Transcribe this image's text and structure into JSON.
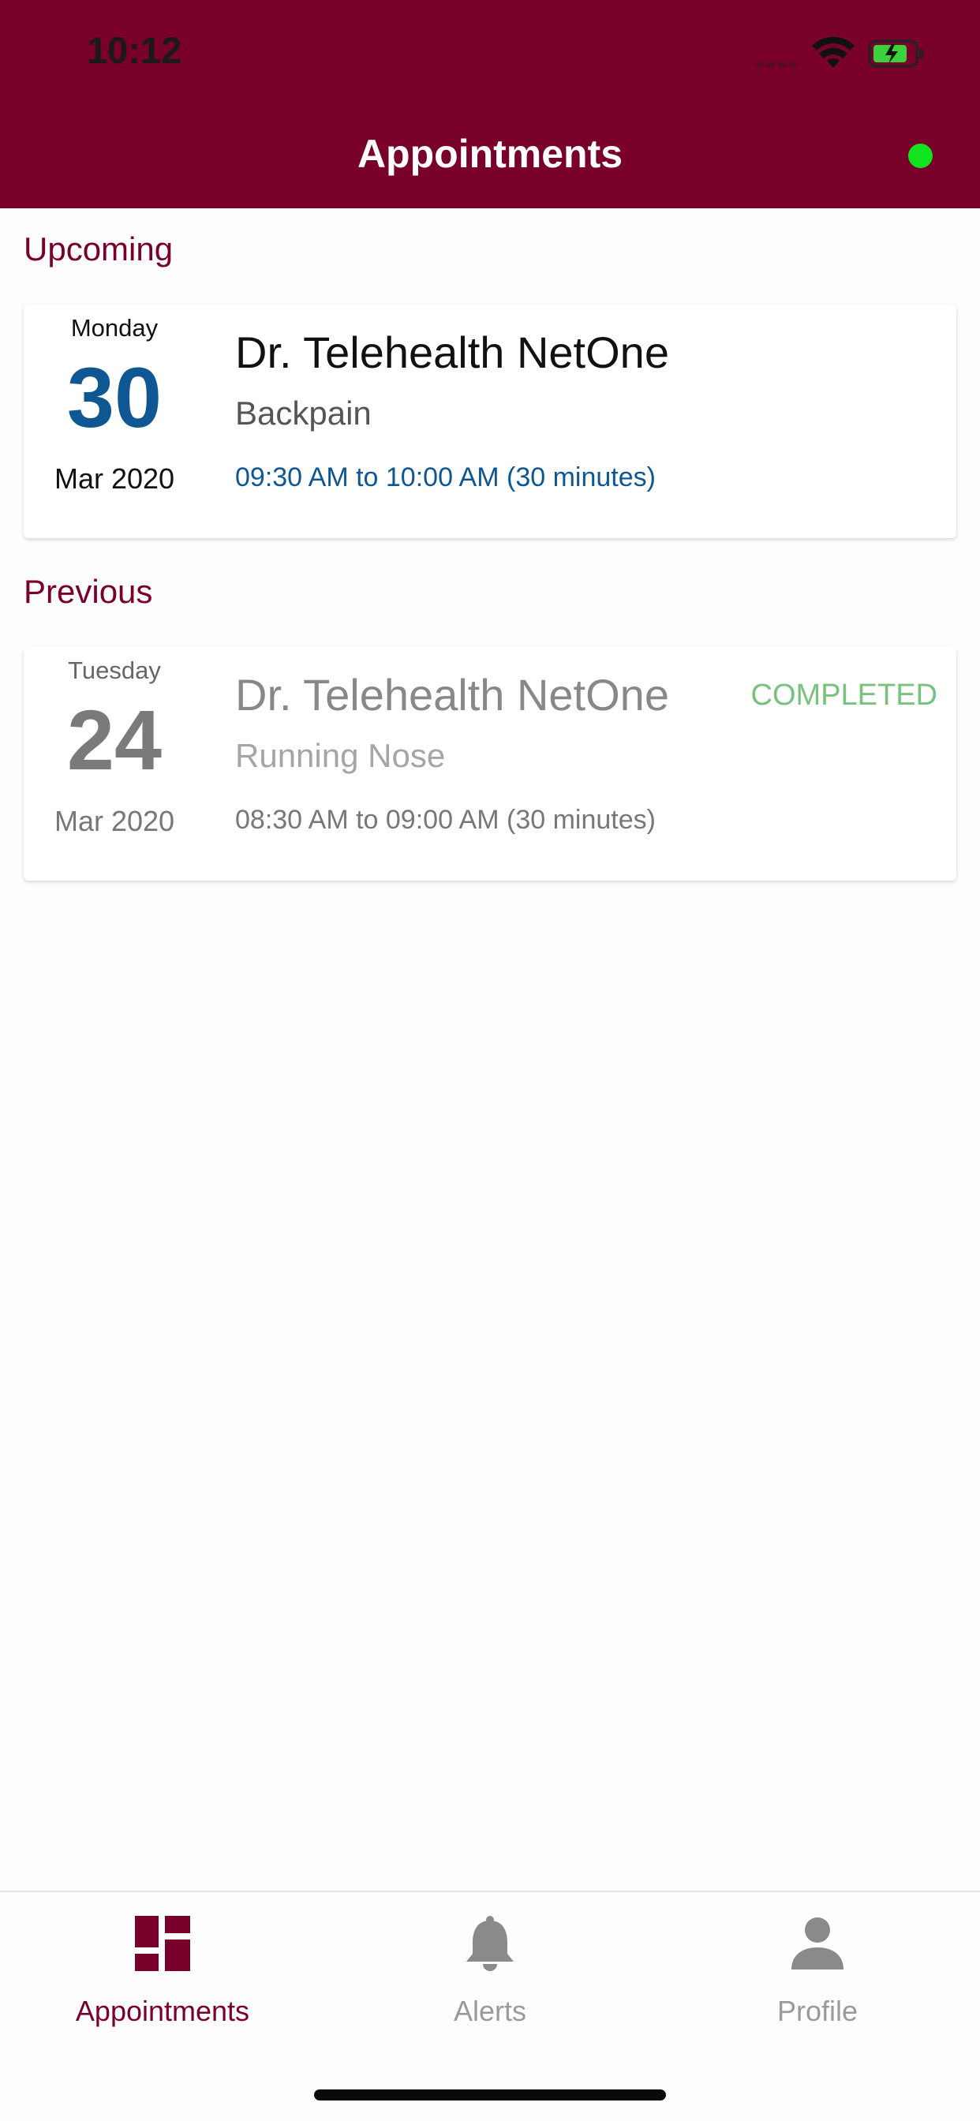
{
  "status_bar": {
    "time": "10:12"
  },
  "header": {
    "title": "Appointments",
    "online_color": "#12e31f"
  },
  "sections": {
    "upcoming_label": "Upcoming",
    "previous_label": "Previous"
  },
  "upcoming": [
    {
      "weekday": "Monday",
      "day": "30",
      "month_year": "Mar 2020",
      "doctor": "Dr. Telehealth NetOne",
      "reason": "Backpain",
      "time_range": "09:30 AM to 10:00 AM (30 minutes)"
    }
  ],
  "previous": [
    {
      "weekday": "Tuesday",
      "day": "24",
      "month_year": "Mar 2020",
      "doctor": "Dr. Telehealth NetOne",
      "reason": "Running Nose",
      "time_range": "08:30 AM to 09:00 AM (30 minutes)",
      "status": "COMPLETED"
    }
  ],
  "tabbar": {
    "items": [
      {
        "label": "Appointments",
        "icon": "dashboard-icon",
        "active": true
      },
      {
        "label": "Alerts",
        "icon": "bell-icon",
        "active": false
      },
      {
        "label": "Profile",
        "icon": "person-icon",
        "active": false
      }
    ]
  },
  "colors": {
    "brand": "#78002b",
    "date_accent": "#0f5793",
    "completed": "#77c27d"
  }
}
